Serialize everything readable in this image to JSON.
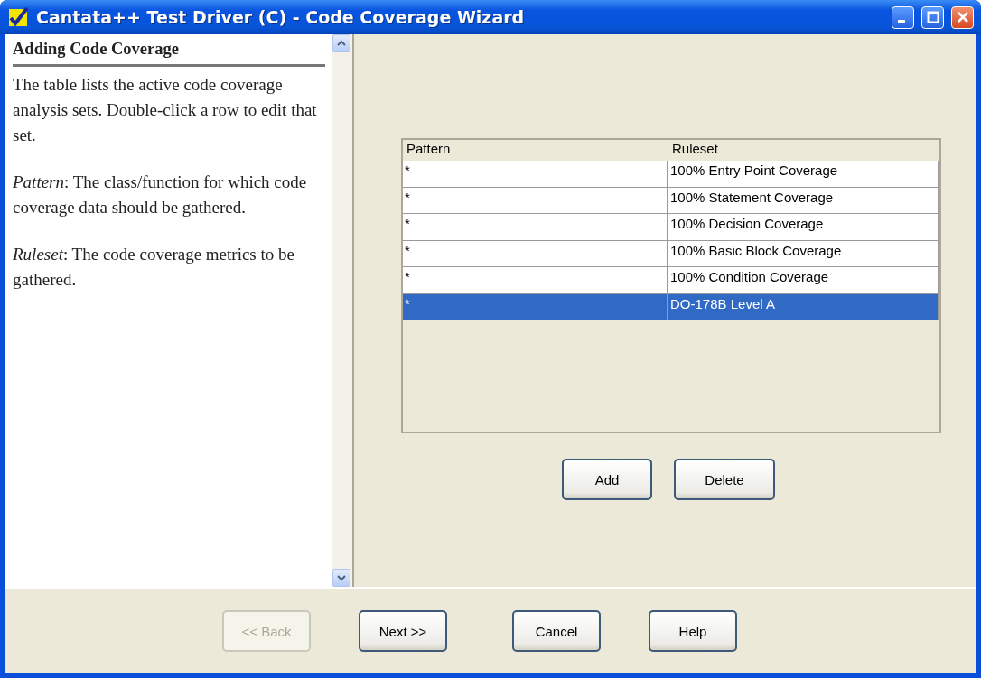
{
  "window": {
    "title": "Cantata++ Test Driver (C) - Code Coverage Wizard"
  },
  "help": {
    "heading": "Adding Code Coverage",
    "paragraphs": [
      "The table lists the active code coverage analysis sets. Double-click a row to edit that set.",
      "*Pattern*: The class/function for which code coverage data should be gathered.",
      "*Ruleset*: The code coverage metrics to be gathered."
    ]
  },
  "table": {
    "columns": [
      "Pattern",
      "Ruleset"
    ],
    "rows": [
      {
        "pattern": "*",
        "ruleset": "100% Entry Point Coverage",
        "selected": false
      },
      {
        "pattern": "*",
        "ruleset": "100% Statement Coverage",
        "selected": false
      },
      {
        "pattern": "*",
        "ruleset": "100% Decision Coverage",
        "selected": false
      },
      {
        "pattern": "*",
        "ruleset": "100% Basic Block Coverage",
        "selected": false
      },
      {
        "pattern": "*",
        "ruleset": "100% Condition Coverage",
        "selected": false
      },
      {
        "pattern": "*",
        "ruleset": "DO-178B Level A",
        "selected": true
      }
    ]
  },
  "table_buttons": [
    {
      "label": "Add",
      "disabled": false
    },
    {
      "label": "Delete",
      "disabled": false
    }
  ],
  "wizard_buttons": [
    {
      "label": "<< Back",
      "disabled": true
    },
    {
      "label": "Next >>",
      "disabled": false
    },
    {
      "label": "Cancel",
      "disabled": false
    },
    {
      "label": "Help",
      "disabled": false
    }
  ]
}
